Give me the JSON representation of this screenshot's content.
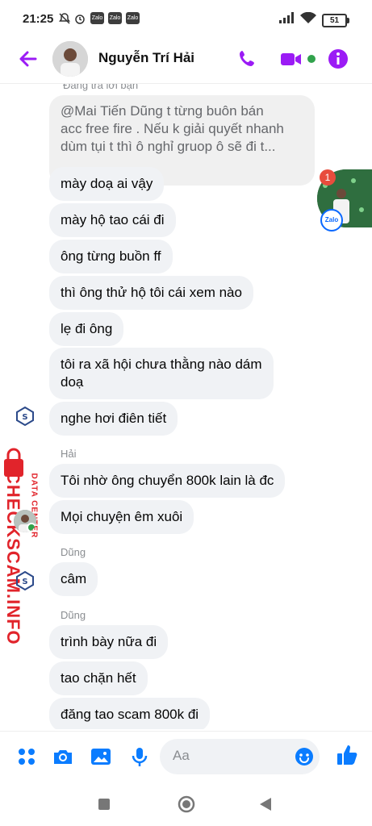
{
  "status_bar": {
    "time": "21:25",
    "notification_apps": [
      "Zalo",
      "Zalo",
      "Zalo"
    ],
    "battery": "51"
  },
  "header": {
    "contact_name": "Nguyễn Trí Hải",
    "accent_color": "#9b1bf5"
  },
  "chat": {
    "reply_hint": "Đang trả lời bạn",
    "quoted_message": "@Mai Tiến Dũng t từng buôn bán\nacc free fire . Nếu k giải quyết nhanh\ndùm tụi t thì ô nghỉ gruop ô sẽ đi t...",
    "group1": [
      "mày doạ ai vậy",
      "mày hộ tao cái đi",
      "ông từng buồn ff",
      "thì ông thử hộ tôi cái xem nào",
      "lẹ đi ông",
      "tôi ra xã hội chưa thằng nào dám\ndoạ",
      "nghe hơi điên tiết"
    ],
    "sender_hai": "Hải",
    "group2": [
      "Tôi nhờ ông chuyển 800k lain là đc",
      "Mọi chuyện êm xuôi"
    ],
    "sender_dung_1": "Dũng",
    "group3": [
      "câm"
    ],
    "sender_dung_2": "Dũng",
    "group4": [
      "trình bày nữa đi",
      "tao chặn hết",
      "đăng tao scam 800k đi"
    ]
  },
  "overlay": {
    "notification_count": "1",
    "zalo_label": "Zalo",
    "watermark_site": "CHECKSCAM.INFO",
    "watermark_sub": "DATA CENTER"
  },
  "composer": {
    "placeholder": "Aa"
  },
  "colors": {
    "bubble": "#f0f2f5",
    "watermark_red": "#e1242b",
    "icon_blue": "#0a7cff"
  }
}
